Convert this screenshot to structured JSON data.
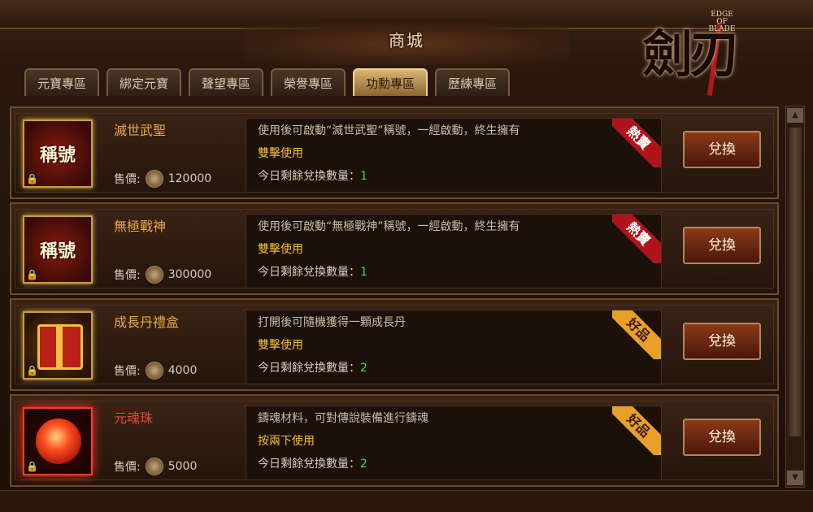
{
  "window": {
    "title": "商城"
  },
  "logo": {
    "glyphs": "劍刃",
    "subtitle_line1": "EDGE OF",
    "subtitle_line2": "BLADE"
  },
  "tabs": [
    {
      "label": "元寶專區",
      "active": false
    },
    {
      "label": "綁定元寶",
      "active": false
    },
    {
      "label": "聲望專區",
      "active": false
    },
    {
      "label": "榮譽專區",
      "active": false
    },
    {
      "label": "功勳專區",
      "active": true
    },
    {
      "label": "歷練專區",
      "active": false
    }
  ],
  "items": [
    {
      "name": "滅世武聖",
      "icon": "title-badge-icon",
      "icon_label": "稱號",
      "price_label": "售價:",
      "price": "120000",
      "desc": "使用後可啟動“滅世武聖”稱號，一經啟動，終生擁有",
      "usage": "雙擊使用",
      "remaining_label": "今日剩餘兌換數量：",
      "remaining": "1",
      "ribbon": "熱賣",
      "button": "兌換"
    },
    {
      "name": "無極戰神",
      "icon": "title-badge-icon",
      "icon_label": "稱號",
      "price_label": "售價:",
      "price": "300000",
      "desc": "使用後可啟動“無極戰神”稱號，一經啟動，終生擁有",
      "usage": "雙擊使用",
      "remaining_label": "今日剩餘兌換數量：",
      "remaining": "1",
      "ribbon": "熱賣",
      "button": "兌換"
    },
    {
      "name": "成長丹禮盒",
      "icon": "gift-box-icon",
      "icon_label": "",
      "price_label": "售價:",
      "price": "4000",
      "desc": "打開後可隨機獲得一顆成長丹",
      "usage": "雙擊使用",
      "remaining_label": "今日剩餘兌換數量：",
      "remaining": "2",
      "ribbon": "好品",
      "button": "兌換"
    },
    {
      "name": "元魂珠",
      "icon": "soul-orb-icon",
      "icon_label": "",
      "price_label": "售價:",
      "price": "5000",
      "desc": "鑄魂材料，可對傳說裝備進行鑄魂",
      "usage": "按兩下使用",
      "remaining_label": "今日剩餘兌換數量：",
      "remaining": "2",
      "ribbon": "好品",
      "button": "兌換"
    }
  ],
  "colors": {
    "accent": "#f0c040",
    "count": "#40e040",
    "ribbon_hot": "#b0141a",
    "ribbon_good": "#e8a028"
  }
}
